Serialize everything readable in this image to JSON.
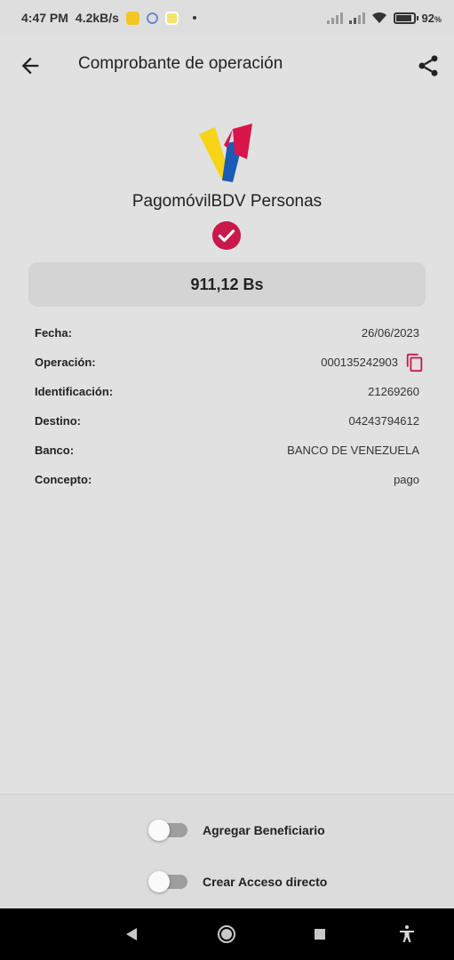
{
  "status_bar": {
    "time": "4:47 PM",
    "speed": "4.2kB/s",
    "battery": "92",
    "battery_unit": "%",
    "battery_level": 0.92,
    "notification_icons": [
      "emoji-icon",
      "settings-badge-icon",
      "smiley-icon"
    ],
    "signal_icons": [
      "signal-icon",
      "signal-icon",
      "wifi-icon"
    ]
  },
  "app_bar": {
    "back_icon": "arrow-left-icon",
    "title": "Comprobante de operación",
    "share_icon": "share-icon"
  },
  "receipt": {
    "brand": "PagomóvilBDV Personas",
    "status_icon": "check-circle-icon",
    "amount": "911,12 Bs",
    "details": [
      {
        "label": "Fecha:",
        "value": "26/06/2023"
      },
      {
        "label": "Operación:",
        "value": "000135242903",
        "copy_icon": "copy-icon"
      },
      {
        "label": "Identificación:",
        "value": "21269260"
      },
      {
        "label": "Destino:",
        "value": "04243794612"
      },
      {
        "label": "Banco:",
        "value": "BANCO DE VENEZUELA"
      },
      {
        "label": "Concepto:",
        "value": "pago"
      }
    ]
  },
  "options": {
    "add_beneficiary": {
      "label": "Agregar Beneficiario",
      "on": false
    },
    "create_shortcut": {
      "label": "Crear Acceso directo",
      "on": false
    }
  },
  "colors": {
    "accent": "#c8194a",
    "logo_yellow": "#f7d417",
    "logo_blue": "#1a5bb5",
    "logo_red": "#d8164b"
  },
  "nav_bar": {
    "icons": [
      "back-triangle-icon",
      "home-circle-icon",
      "recents-square-icon",
      "accessibility-icon"
    ]
  }
}
